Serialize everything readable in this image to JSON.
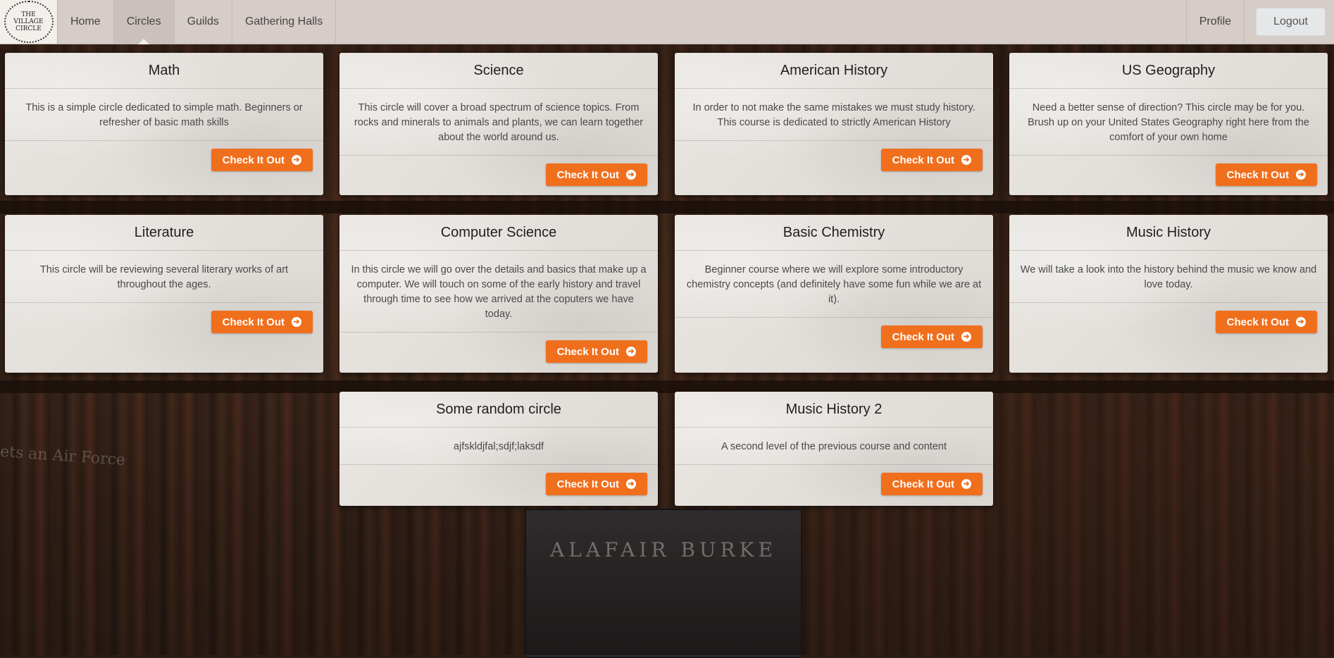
{
  "logo": {
    "lines": [
      "THE",
      "VILLAGE",
      "CIRCLE"
    ]
  },
  "nav": {
    "items": [
      "Home",
      "Circles",
      "Guilds",
      "Gathering Halls"
    ],
    "active": "Circles",
    "profile": "Profile",
    "logout": "Logout"
  },
  "button_label": "Check It Out",
  "cards": [
    {
      "title": "Math",
      "description": "This is a simple circle dedicated to simple math. Beginners or refresher of basic math skills"
    },
    {
      "title": "Science",
      "description": "This circle will cover a broad spectrum of science topics. From rocks and minerals to animals and plants, we can learn together about the world around us."
    },
    {
      "title": "American History",
      "description": "In order to not make the same mistakes we must study history. This course is dedicated to strictly American History"
    },
    {
      "title": "US Geography",
      "description": "Need a better sense of direction? This circle may be for you. Brush up on your United States Geography right here from the comfort of your own home"
    },
    {
      "title": "Literature",
      "description": "This circle will be reviewing several literary works of art throughout the ages."
    },
    {
      "title": "Computer Science",
      "description": "In this circle we will go over the details and basics that make up a computer. We will touch on some of the early history and travel through time to see how we arrived at the coputers we have today."
    },
    {
      "title": "Basic Chemistry",
      "description": "Beginner course where we will explore some introductory chemistry concepts (and definitely have some fun while we are at it)."
    },
    {
      "title": "Music History",
      "description": "We will take a look into the history behind the music we know and love today."
    },
    {
      "title": "Some random circle",
      "description": "ajfskldjfal;sdjf;laksdf"
    },
    {
      "title": "Music History 2",
      "description": "A second level of the previous course and content"
    }
  ],
  "background": {
    "book_title": "ALAFAIR BURKE",
    "spine_text": "ets an Air Force"
  },
  "colors": {
    "accent": "#f06f1d",
    "navbar": "#d6ccc8"
  }
}
